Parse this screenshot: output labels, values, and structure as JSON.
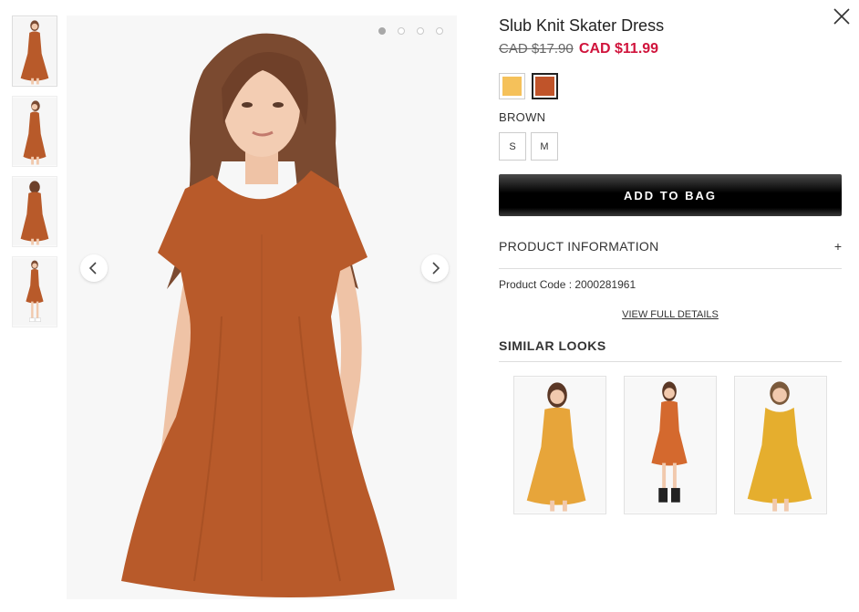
{
  "product": {
    "title": "Slub Knit Skater Dress",
    "price_original": "CAD $17.90",
    "price_sale": "CAD $11.99",
    "selected_color": "BROWN",
    "swatches": [
      {
        "name": "mustard",
        "color": "#f5c15a"
      },
      {
        "name": "brown",
        "color": "#c0542a"
      }
    ],
    "sizes": [
      "S",
      "M"
    ],
    "add_to_bag": "ADD TO BAG",
    "info_label": "PRODUCT INFORMATION",
    "info_toggle": "+",
    "product_code": "Product Code : 2000281961",
    "view_full": "VIEW FULL DETAILS"
  },
  "similar": {
    "title": "SIMILAR LOOKS",
    "items": [
      {
        "color": "#e7a53a"
      },
      {
        "color": "#d4692e"
      },
      {
        "color": "#e5ae2e"
      }
    ]
  },
  "gallery": {
    "dress_color": "#b85a2a",
    "image_count": 4,
    "active_index": 0
  },
  "icons": {
    "close": "close-icon",
    "prev": "chevron-left-icon",
    "next": "chevron-right-icon"
  }
}
